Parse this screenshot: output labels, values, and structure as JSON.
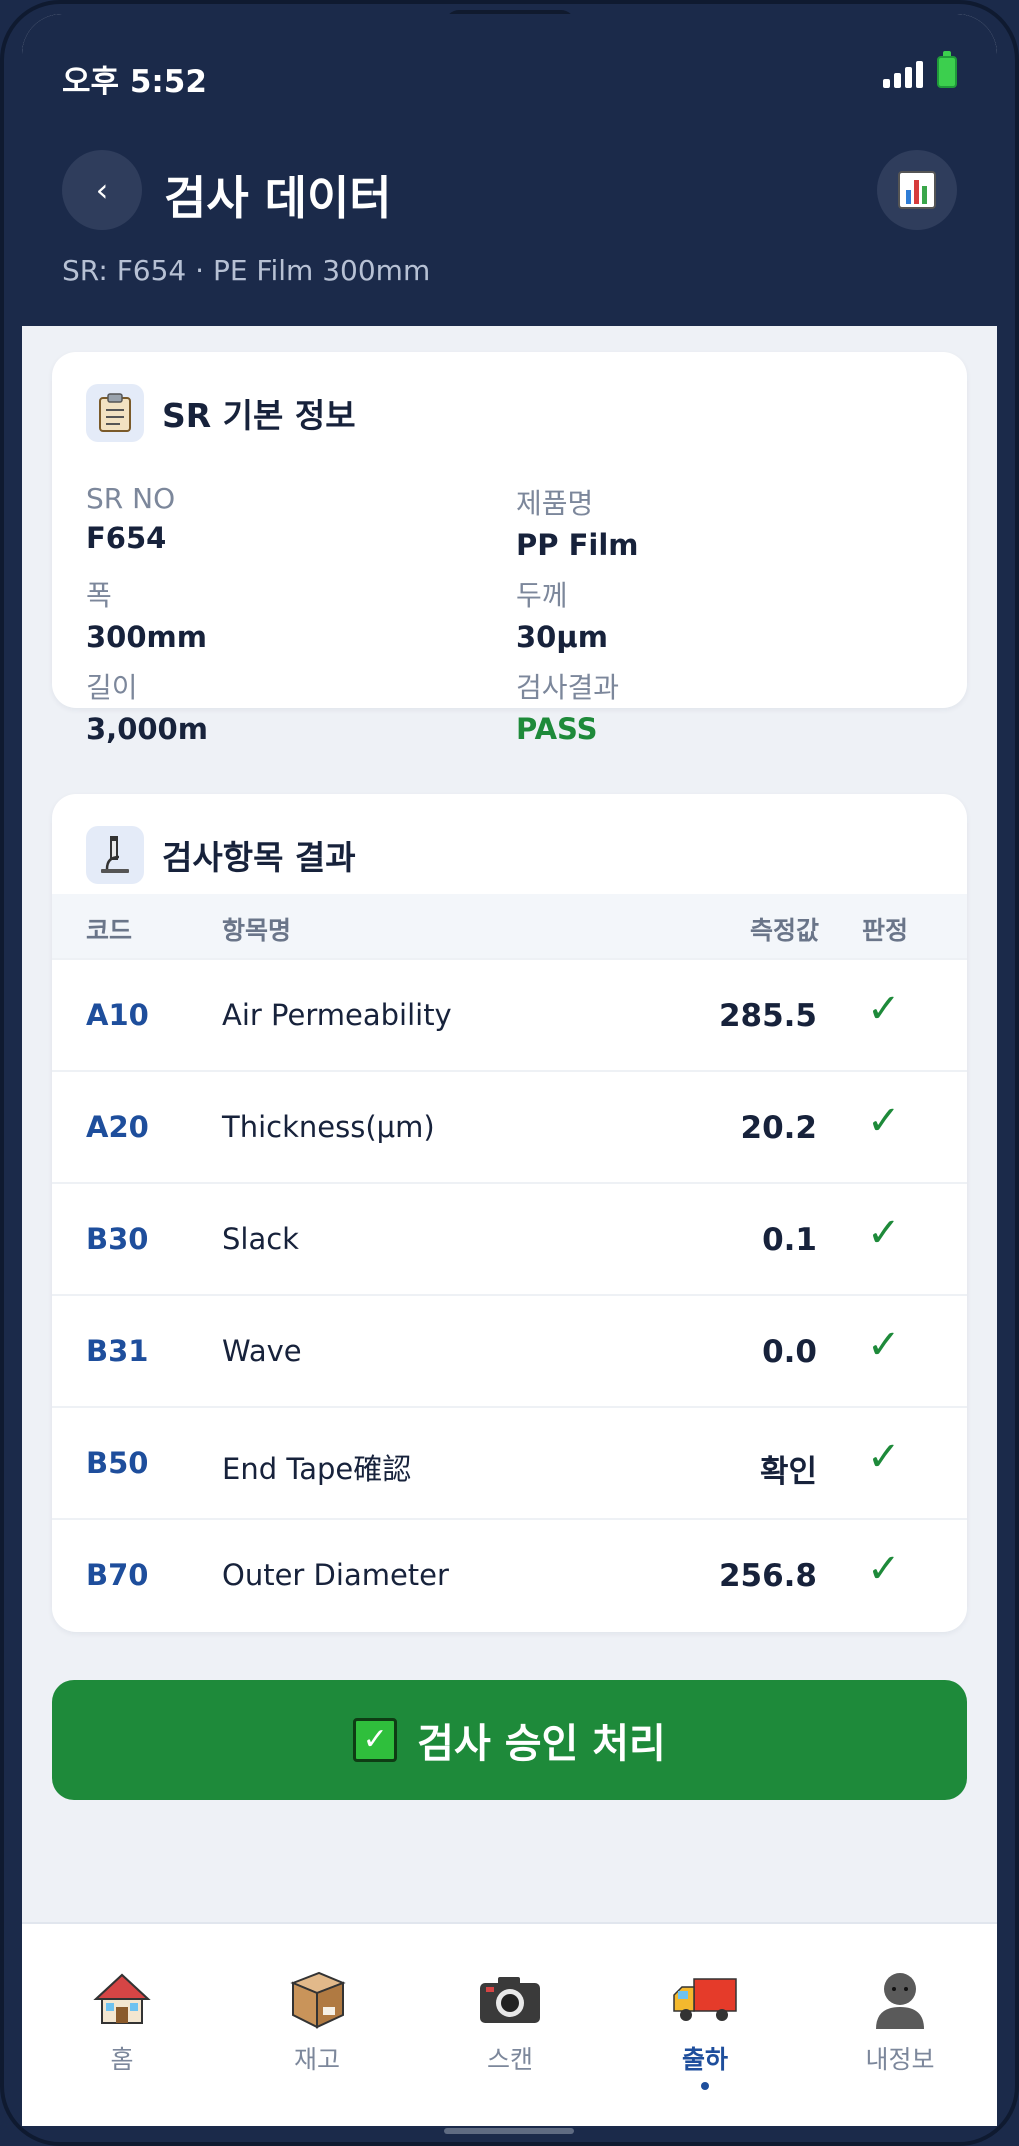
{
  "status_bar": {
    "time": "오후 5:52"
  },
  "header": {
    "title": "검사 데이터",
    "subtitle": "SR: F654 · PE Film 300mm",
    "back_label": "‹"
  },
  "info_card": {
    "title": "SR 기본 정보",
    "fields": [
      {
        "label": "SR NO",
        "value": "F654"
      },
      {
        "label": "제품명",
        "value": "PP Film"
      },
      {
        "label": "폭",
        "value": "300mm"
      },
      {
        "label": "두께",
        "value": "30μm"
      },
      {
        "label": "길이",
        "value": "3,000m"
      },
      {
        "label": "검사결과",
        "value": "PASS"
      }
    ]
  },
  "results_card": {
    "title": "검사항목 결과",
    "columns": {
      "code": "코드",
      "name": "항목명",
      "value": "측정값",
      "judge": "판정"
    },
    "rows": [
      {
        "code": "A10",
        "name": "Air Permeability",
        "value": "285.5",
        "judge": "✓"
      },
      {
        "code": "A20",
        "name": "Thickness(μm)",
        "value": "20.2",
        "judge": "✓"
      },
      {
        "code": "B30",
        "name": "Slack",
        "value": "0.1",
        "judge": "✓"
      },
      {
        "code": "B31",
        "name": "Wave",
        "value": "0.0",
        "judge": "✓"
      },
      {
        "code": "B50",
        "name": "End Tape確認",
        "value": "확인",
        "judge": "✓"
      },
      {
        "code": "B70",
        "name": "Outer Diameter",
        "value": "256.8",
        "judge": "✓"
      }
    ]
  },
  "approve_button": {
    "label": "검사 승인 처리"
  },
  "bottom_nav": {
    "items": [
      {
        "label": "홈",
        "icon": "home-icon"
      },
      {
        "label": "재고",
        "icon": "box-icon"
      },
      {
        "label": "스캔",
        "icon": "camera-icon"
      },
      {
        "label": "출하",
        "icon": "truck-icon",
        "active": true
      },
      {
        "label": "내정보",
        "icon": "person-icon"
      }
    ]
  },
  "colors": {
    "header_bg": "#1b2a4a",
    "accent_blue": "#1e4e9c",
    "pass_green": "#1e8a3a"
  }
}
